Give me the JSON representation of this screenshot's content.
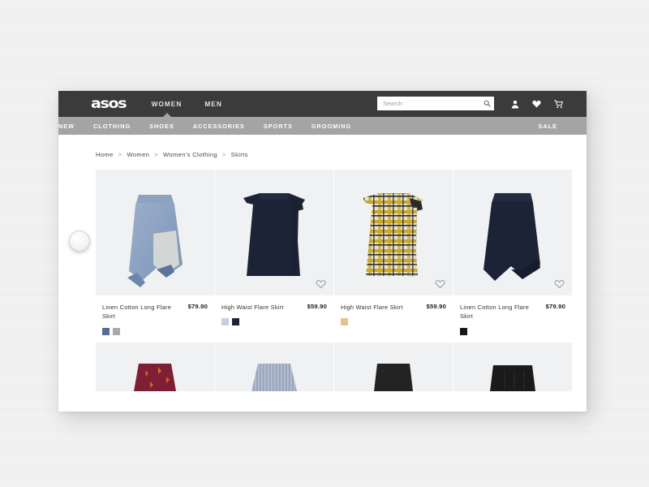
{
  "site": {
    "logo": "asos",
    "brand_dark": "#3b3b3b",
    "brand_gray": "#a4a4a4"
  },
  "header": {
    "primary_nav": [
      {
        "label": "WOMEN",
        "active": true
      },
      {
        "label": "MEN",
        "active": false
      }
    ],
    "search": {
      "placeholder": "Search",
      "value": "",
      "icon": "search-icon"
    },
    "icons": [
      {
        "name": "account-icon"
      },
      {
        "name": "wishlist-heart-icon"
      },
      {
        "name": "shopping-cart-icon"
      }
    ]
  },
  "nav": {
    "items": [
      "NEW",
      "CLOTHING",
      "SHOES",
      "ACCESSORIES",
      "SPORTS",
      "GROOMING"
    ],
    "sale_label": "SALE"
  },
  "breadcrumb": {
    "items": [
      "Home",
      "Women",
      "Women's Clothing",
      "Skirts"
    ],
    "separator": ">"
  },
  "products": [
    {
      "title": "Linen Cotton Long Flare Skirt",
      "price": "$79.90",
      "swatches": [
        "#5a6a93",
        "#a8a9ab"
      ],
      "image": "blue-asymmetric-skirt",
      "wishlist_icon": "heart-outline-icon"
    },
    {
      "title": "High Waist Flare Skirt",
      "price": "$59.90",
      "swatches": [
        "#c9cddd",
        "#1d2438"
      ],
      "image": "navy-flare-skirt-with-tie",
      "wishlist_icon": "heart-outline-icon"
    },
    {
      "title": "High Waist Flare Skirt",
      "price": "$59.90",
      "swatches": [
        "#e7c28d"
      ],
      "image": "yellow-plaid-wrap-skirt",
      "wishlist_icon": "heart-outline-icon"
    },
    {
      "title": "Linen Cotton Long Flare Skirt",
      "price": "$79.90",
      "swatches": [
        "#17181d"
      ],
      "image": "navy-asymmetric-hem-skirt",
      "wishlist_icon": "heart-outline-icon"
    }
  ],
  "products_row2": [
    {
      "image": "burgundy-printed-skirt",
      "color": "#7d1f35"
    },
    {
      "image": "blue-gray-striped-skirt",
      "color": "#8e9bb4"
    },
    {
      "image": "black-skirt",
      "color": "#232323"
    },
    {
      "image": "black-pleated-skirt",
      "color": "#1a1a1a"
    }
  ],
  "device": {
    "knob": "circle-knob"
  }
}
